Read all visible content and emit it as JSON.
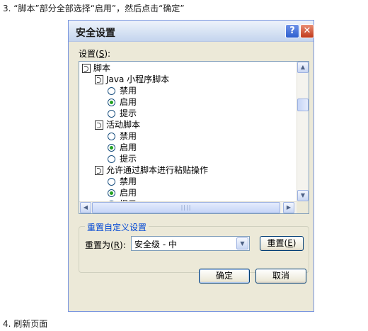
{
  "instructions": {
    "step3": "3. “脚本”部分全部选择“启用”，然后点击“确定”",
    "step4": "4. 刷新页面"
  },
  "dialog": {
    "title": "安全设置",
    "help_label": "?",
    "close_label": "✕",
    "settings_label": "设置",
    "settings_key": "S",
    "tree": {
      "root": "脚本",
      "java_applet": "Java 小程序脚本",
      "active_scripting": "活动脚本",
      "paste_via_script": "允许通过脚本进行粘贴操作",
      "opt_disable": "禁用",
      "opt_enable": "启用",
      "opt_prompt": "提示",
      "selected": "启用"
    },
    "reset_group": {
      "title": "重置自定义设置",
      "reset_to_label": "重置为",
      "reset_to_key": "R",
      "level_value": "安全级 - 中",
      "reset_button": "重置",
      "reset_key": "E"
    },
    "ok_label": "确定",
    "cancel_label": "取消"
  },
  "colors": {
    "dialog_bg": "#ece9d8",
    "group_title": "#0046d5",
    "radio_selected": "#21a121",
    "close_button": "#c0391b"
  },
  "icons": [
    "help-icon",
    "close-icon",
    "script-icon",
    "radio-icon",
    "arrow-up-icon",
    "arrow-down-icon",
    "arrow-left-icon",
    "arrow-right-icon",
    "dropdown-arrow-icon"
  ]
}
